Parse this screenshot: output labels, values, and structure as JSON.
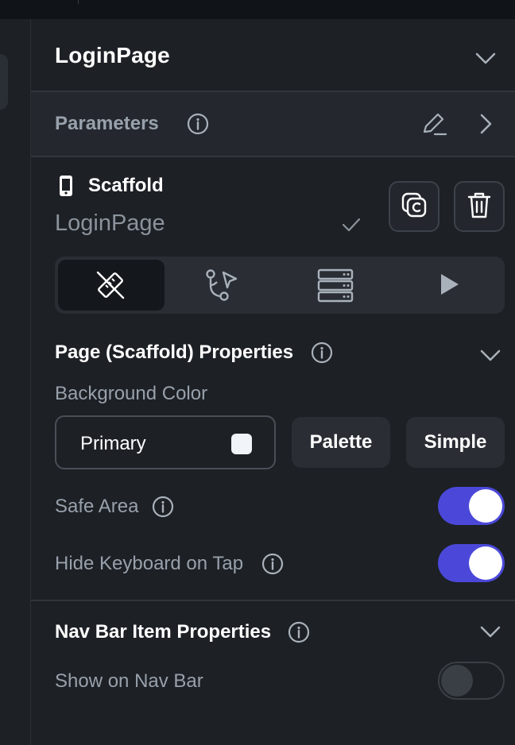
{
  "page": {
    "title": "LoginPage",
    "parameters_label": "Parameters"
  },
  "widget": {
    "type_label": "Scaffold",
    "name": "LoginPage"
  },
  "tabs": [
    {
      "icon": "properties-icon",
      "active": true
    },
    {
      "icon": "actions-flow-icon",
      "active": false
    },
    {
      "icon": "backend-query-icon",
      "active": false
    },
    {
      "icon": "play-icon",
      "active": false
    }
  ],
  "page_properties": {
    "title": "Page (Scaffold) Properties",
    "background_color_label": "Background Color",
    "background_color_value": "Primary",
    "swatch_color": "#f1f4f8",
    "palette_label": "Palette",
    "simple_label": "Simple",
    "safe_area_label": "Safe Area",
    "safe_area_on": true,
    "hide_keyboard_label": "Hide Keyboard on Tap",
    "hide_keyboard_on": true
  },
  "nav_bar": {
    "title": "Nav Bar Item Properties",
    "show_on_nav_bar_label": "Show on Nav Bar",
    "show_on_nav_bar_on": false
  },
  "colors": {
    "accent": "#4b48d9",
    "panel_bg": "#1d2025",
    "muted_text": "#98a1ab"
  }
}
